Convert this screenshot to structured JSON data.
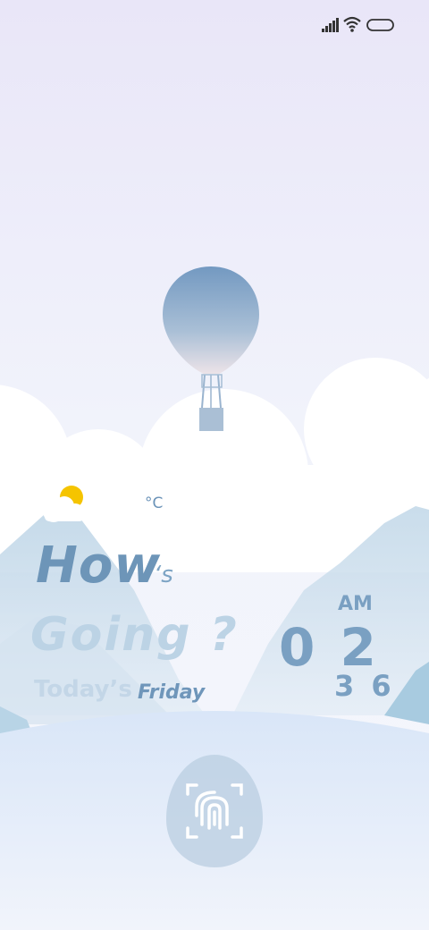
{
  "status_bar": {
    "signal_icon": "cellular-signal-icon",
    "wifi_icon": "wifi-icon",
    "battery_icon": "battery-icon"
  },
  "colors": {
    "sky_top": "#ebe8f8",
    "sky_bottom": "#f4f6fc",
    "accent_blue": "#6d95b8",
    "balloon_top": "#7ba0c6",
    "sun": "#f5c400"
  },
  "weather": {
    "icon": "partly-cloudy-icon",
    "temperature_unit": "°C"
  },
  "greeting": {
    "how": "How",
    "apostrophe_s": "‘s",
    "going": "Going ?",
    "today_label": "Today’s",
    "day": "Friday"
  },
  "clock": {
    "ampm": "AM",
    "hour": "0 2",
    "minute": "3 6"
  },
  "unlock": {
    "icon": "fingerprint-icon"
  }
}
